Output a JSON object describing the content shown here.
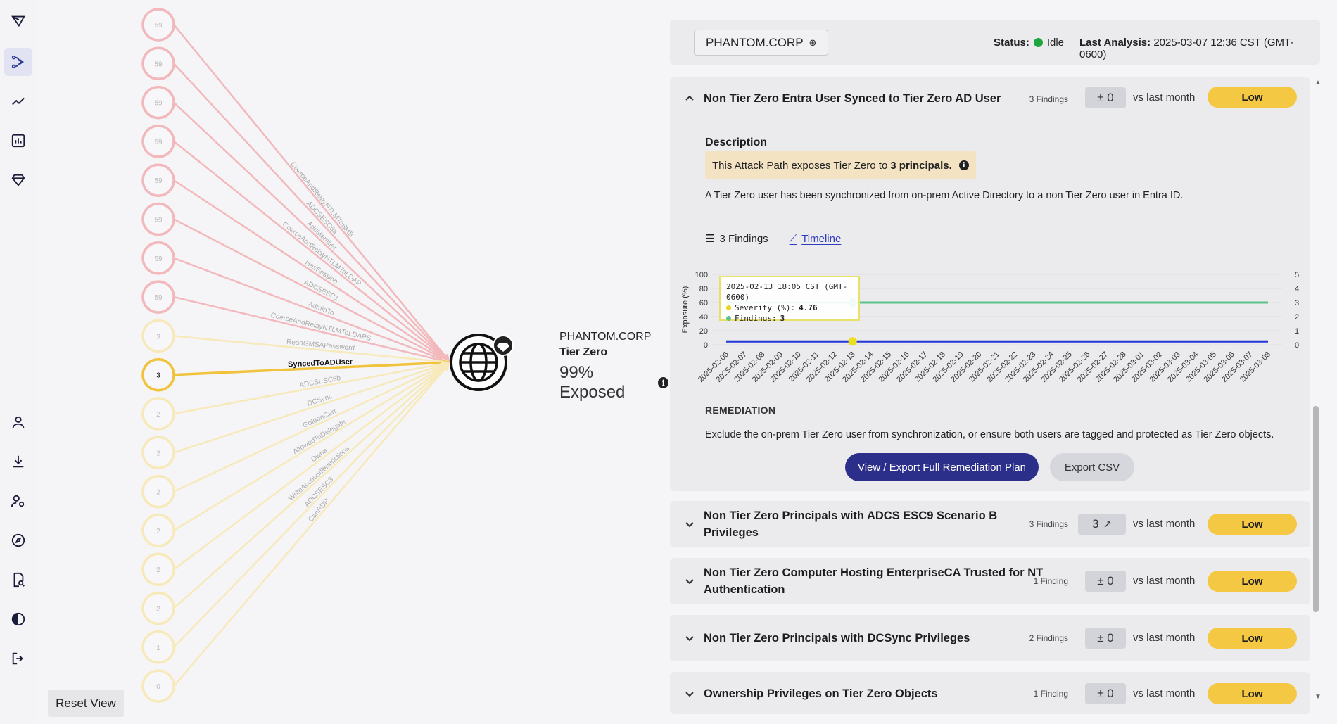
{
  "sidebar": {
    "items": [
      {
        "name": "logo-icon"
      },
      {
        "name": "attack-paths-icon",
        "active": true
      },
      {
        "name": "trends-icon"
      },
      {
        "name": "reports-icon"
      },
      {
        "name": "tier-zero-icon"
      },
      {
        "name": "user-icon"
      },
      {
        "name": "download-icon"
      },
      {
        "name": "admin-users-icon"
      },
      {
        "name": "explore-icon"
      },
      {
        "name": "search-doc-icon"
      },
      {
        "name": "theme-toggle-icon"
      },
      {
        "name": "logout-icon"
      }
    ]
  },
  "graph": {
    "reset_label": "Reset View",
    "target": {
      "domain": "PHANTOM.CORP",
      "tier": "Tier Zero",
      "exposed": "99% Exposed"
    },
    "nodes": [
      "59",
      "59",
      "59",
      "59",
      "59",
      "59",
      "59",
      "59",
      "3",
      "3",
      "2",
      "2",
      "2",
      "2",
      "2",
      "2",
      "1",
      "0"
    ],
    "edge_labels": [
      "CoerceAndRelayNTLMToSMB",
      "ADCSESC6a",
      "AddMember",
      "CoerceAndRelayNTLMToLDAP",
      "HasSession",
      "ADCSESC1",
      "AdminTo",
      "CoerceAndRelayNTLMToLDAPS",
      "ReadGMSAPassword",
      "SyncedToADUser",
      "ADCSESC6b",
      "DCSync",
      "GoldenCert",
      "AllowedToDelegate",
      "Owns",
      "WriteAccountRestrictions",
      "ADCSESC3",
      "CanRDP"
    ],
    "highlighted_edge": "SyncedToADUser",
    "colors": {
      "tier_zero_edge": "#f2b8bc",
      "other_edge": "#f7e9b9",
      "highlight": "#f1c23b"
    }
  },
  "topbar": {
    "domain": "PHANTOM.CORP",
    "status_label": "Status:",
    "status_value": "Idle",
    "last_label": "Last Analysis:",
    "last_value": "2025-03-07 12:36 CST (GMT-0600)"
  },
  "expanded": {
    "title": "Non Tier Zero Entra User Synced to Tier Zero AD User",
    "findings": "3 Findings",
    "delta": "± 0",
    "vs": "vs last month",
    "severity": "Low",
    "description_heading": "Description",
    "note_prefix": "This Attack Path exposes Tier Zero to ",
    "note_bold": "3 principals.",
    "description": "A Tier Zero user has been synchronized from on-prem Active Directory to a non Tier Zero user in Entra ID.",
    "tab_findings": "3 Findings",
    "tab_timeline": "Timeline",
    "remediation_heading": "REMEDIATION",
    "remediation": "Exclude the on-prem Tier Zero user from synchronization, or ensure both users are tagged and protected as Tier Zero objects.",
    "primary_button": "View / Export Full Remediation Plan",
    "secondary_button": "Export CSV",
    "tooltip": {
      "date": "2025-02-13 18:05 CST (GMT-0600)",
      "severity_label": "Severity (%):",
      "severity_value": "4.76",
      "findings_label": "Findings:",
      "findings_value": "3"
    }
  },
  "collapsed": [
    {
      "title1": "Non Tier Zero Principals with ADCS ESC9 Scenario B",
      "title2": "Privileges",
      "findings": "3 Findings",
      "delta": "3",
      "trend_up": true,
      "vs": "vs last month",
      "severity": "Low"
    },
    {
      "title1": "Non Tier Zero Computer Hosting EnterpriseCA Trusted for NT",
      "title2": "Authentication",
      "findings": "1 Finding",
      "delta": "± 0",
      "vs": "vs last month",
      "severity": "Low"
    },
    {
      "title1": "Non Tier Zero Principals with DCSync Privileges",
      "title2": "",
      "findings": "2 Findings",
      "delta": "± 0",
      "vs": "vs last month",
      "severity": "Low"
    },
    {
      "title1": "Ownership Privileges on Tier Zero Objects",
      "title2": "",
      "findings": "1 Finding",
      "delta": "± 0",
      "vs": "vs last month",
      "severity": "Low"
    }
  ],
  "chart_data": {
    "type": "line",
    "ylabel": "Exposure (%)",
    "y2label": "Findings",
    "ylim": [
      0,
      100
    ],
    "y2lim": [
      0,
      5
    ],
    "yticks": [
      "100",
      "80",
      "60",
      "40",
      "20",
      "0"
    ],
    "y2ticks": [
      "5",
      "4",
      "3",
      "2",
      "1",
      "0"
    ],
    "x": [
      "2025-02-06",
      "2025-02-07",
      "2025-02-08",
      "2025-02-09",
      "2025-02-10",
      "2025-02-11",
      "2025-02-12",
      "2025-02-13",
      "2025-02-14",
      "2025-02-15",
      "2025-02-16",
      "2025-02-17",
      "2025-02-18",
      "2025-02-19",
      "2025-02-20",
      "2025-02-21",
      "2025-02-22",
      "2025-02-23",
      "2025-02-24",
      "2025-02-25",
      "2025-02-26",
      "2025-02-27",
      "2025-02-28",
      "2025-03-01",
      "2025-03-02",
      "2025-03-03",
      "2025-03-04",
      "2025-03-05",
      "2025-03-06",
      "2025-03-07",
      "2025-03-08"
    ],
    "series": [
      {
        "name": "Severity (%)",
        "axis": "left",
        "color": "#2336d6",
        "values": [
          4.76,
          4.76,
          4.76,
          4.76,
          4.76,
          4.76,
          4.76,
          4.76,
          4.76,
          4.76,
          4.76,
          4.76,
          4.76,
          4.76,
          4.76,
          4.76,
          4.76,
          4.76,
          4.76,
          4.76,
          4.76,
          4.76,
          4.76,
          4.76,
          4.76,
          4.76,
          4.76,
          4.76,
          4.76,
          4.76,
          4.76
        ]
      },
      {
        "name": "Findings",
        "axis": "right",
        "color": "#5cc18d",
        "values": [
          3,
          3,
          3,
          3,
          3,
          3,
          3,
          3,
          3,
          3,
          3,
          3,
          3,
          3,
          3,
          3,
          3,
          3,
          3,
          3,
          3,
          3,
          3,
          3,
          3,
          3,
          3,
          3,
          3,
          3,
          3
        ]
      }
    ],
    "highlight_index": 7
  }
}
